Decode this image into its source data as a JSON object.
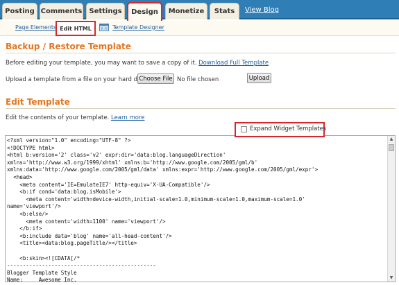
{
  "top_tabs": [
    {
      "label": "Posting"
    },
    {
      "label": "Comments"
    },
    {
      "label": "Settings"
    },
    {
      "label": "Design"
    },
    {
      "label": "Monetize"
    },
    {
      "label": "Stats"
    }
  ],
  "view_blog": "View Blog",
  "sub_tabs": {
    "page_elements": "Page Elements",
    "edit_html": "Edit HTML",
    "template_designer": "Template Designer"
  },
  "backup": {
    "heading": "Backup / Restore Template",
    "intro": "Before editing your template, you may want to save a copy of it.",
    "download_link": "Download Full Template",
    "upload_label": "Upload a template from a file on your hard drive:",
    "choose_file": "Choose File",
    "no_file": "No file chosen",
    "upload_button": "Upload"
  },
  "edit": {
    "heading": "Edit Template",
    "intro": "Edit the contents of your template.",
    "learn_more": "Learn more",
    "expand_widgets": "Expand Widget Templates"
  },
  "code_lines": [
    "<?xml version=\"1.0\" encoding=\"UTF-8\" ?>",
    "<!DOCTYPE html>",
    "<html b:version='2' class='v2' expr:dir='data:blog.languageDirection'",
    "xmlns='http://www.w3.org/1999/xhtml' xmlns:b='http://www.google.com/2005/gml/b'",
    "xmlns:data='http://www.google.com/2005/gml/data' xmlns:expr='http://www.google.com/2005/gml/expr'>",
    "  <head>",
    "    <meta content='IE=EmulateIE7' http-equiv='X-UA-Compatible'/>",
    "    <b:if cond='data:blog.isMobile'>",
    "      <meta content='width=device-width,initial-scale=1.0,minimum-scale=1.0,maximum-scale=1.0'",
    "name='viewport'/>",
    "    <b:else/>",
    "      <meta content='width=1100' name='viewport'/>",
    "    </b:if>",
    "    <b:include data='blog' name='all-head-content'/>",
    "    <title><data:blog.pageTitle/></title>",
    "",
    "    <b:skin><![CDATA[/*",
    "-----------------------------------------------",
    "Blogger Template Style",
    "Name:     Awesome Inc."
  ]
}
